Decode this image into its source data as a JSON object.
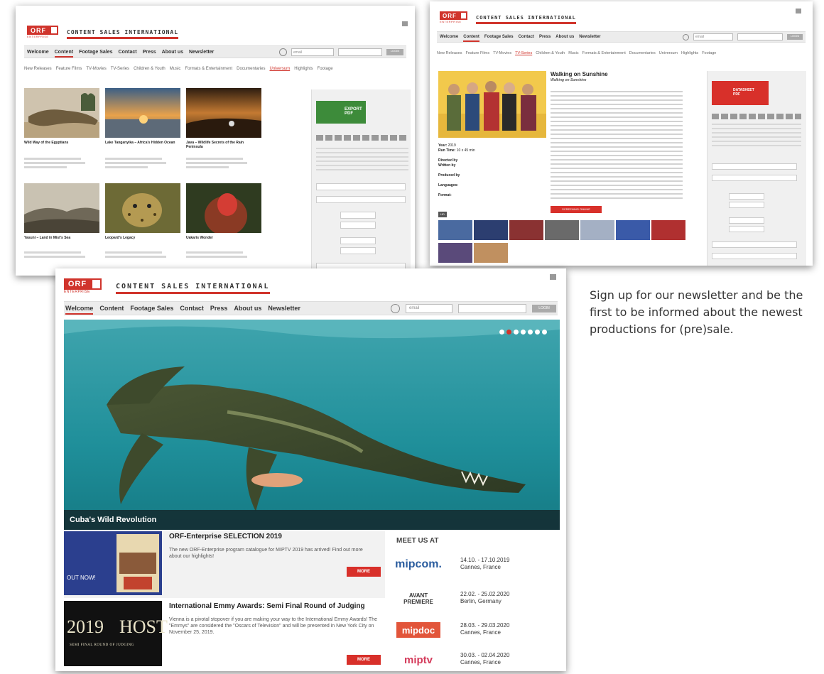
{
  "brand": {
    "logo_letters": "ORF",
    "logo_sub": "ENTERPRISE",
    "tagline": "CONTENT SALES INTERNATIONAL"
  },
  "nav": {
    "items": [
      "Welcome",
      "Content",
      "Footage Sales",
      "Contact",
      "Press",
      "About us",
      "Newsletter"
    ],
    "email_placeholder": "email",
    "login_label": "LOGIN"
  },
  "subnav": [
    "New Releases",
    "Feature Films",
    "TV-Movies",
    "TV-Series",
    "Children & Youth",
    "Music",
    "Formats & Entertainment",
    "Documentaries",
    "Universum",
    "Highlights",
    "Footage"
  ],
  "catalogue": {
    "items": [
      {
        "title": "Wild Way of the Egyptians"
      },
      {
        "title": "Lake Tanganyika – Africa's Hidden Ocean"
      },
      {
        "title": "Java – Wildlife Secrets of the Rain Peninsula"
      },
      {
        "title": "Yasuni – Land in Mist's Sea"
      },
      {
        "title": "Leopard's Legacy"
      },
      {
        "title": "Uakaris Wonder"
      }
    ],
    "export_label": "EXPORT",
    "export_sub": "PDF"
  },
  "detail": {
    "title": "Walking on Sunshine",
    "subtitle": "Walking on Sunshine",
    "year_label": "Year:",
    "year": "2019",
    "runtime_label": "Run Time:",
    "runtime": "10 x 45 min",
    "directed_label": "Directed by",
    "written_label": "Written by",
    "produced_label": "Produced by",
    "languages_label": "Languages:",
    "format_label": "Format:",
    "hd": "HD",
    "watch_label": "SCREENING ONLINE",
    "datasheet_label": "DATASHEET",
    "datasheet_sub": "PDF"
  },
  "hero": {
    "caption": "Cuba's Wild Revolution"
  },
  "news": [
    {
      "title": "ORF-Enterprise SELECTION 2019",
      "body": "The new ORF-Enterprise program catalogue for MIPTV 2019 has arrived! Find out more about our highlights!",
      "badge": "OUT NOW!",
      "more": "MORE"
    },
    {
      "title": "International Emmy Awards: Semi Final Round of Judging",
      "body": "Vienna is a pivotal stopover if you are making your way to the International Emmy Awards! The \"Emmys\" are considered the \"Oscars of Television\" and will be presented in New York City on November 25, 2019.",
      "badge_year": "2019",
      "badge_host": "HOST",
      "badge_line": "SEMI FINAL ROUND OF JUDGING",
      "more": "MORE"
    }
  ],
  "meet": {
    "title": "MEET US AT",
    "events": [
      {
        "logo": "mipcom.",
        "dates": "14.10. - 17.10.2019",
        "place": "Cannes, France"
      },
      {
        "logo": "AVANT PREMIERE",
        "dates": "22.02. - 25.02.2020",
        "place": "Berlin, Germany"
      },
      {
        "logo": "mipdoc",
        "dates": "28.03. - 29.03.2020",
        "place": "Cannes, France"
      },
      {
        "logo": "miptv",
        "dates": "30.03. - 02.04.2020",
        "place": "Cannes, France"
      }
    ]
  },
  "signup": {
    "text": "Sign up for our newsletter and be the first to be informed about the newest productions for (pre)sale."
  },
  "colors": {
    "brand_red": "#d0342c",
    "export_green": "#3d8b3a"
  }
}
